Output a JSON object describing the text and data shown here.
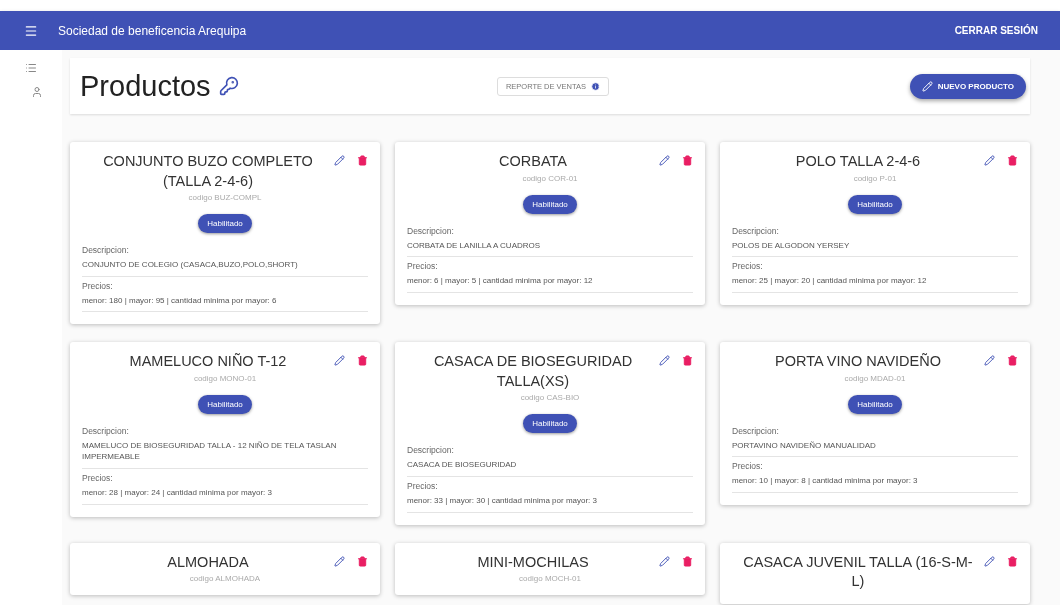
{
  "app_bar": {
    "title": "Sociedad de beneficencia Arequipa",
    "logout": "CERRAR SESIÓN"
  },
  "header": {
    "title": "Productos",
    "report_button": "REPORTE DE VENTAS",
    "new_button": "NUEVO PRODUCTO"
  },
  "products": [
    {
      "name": "CONJUNTO BUZO COMPLETO (TALLA 2-4-6)",
      "code": "codigo BUZ-COMPL",
      "status": "Habilitado",
      "description_label": "Descripcion:",
      "description": "CONJUNTO DE COLEGIO (CASACA,BUZO,POLO,SHORT)",
      "prices_label": "Precios:",
      "prices": "menor: 180 | mayor: 95 | cantidad minima por mayor: 6"
    },
    {
      "name": "CORBATA",
      "code": "codigo COR-01",
      "status": "Habilitado",
      "description_label": "Descripcion:",
      "description": "CORBATA DE LANILLA A CUADROS",
      "prices_label": "Precios:",
      "prices": "menor: 6 | mayor: 5 | cantidad minima por mayor: 12"
    },
    {
      "name": "POLO TALLA 2-4-6",
      "code": "codigo P-01",
      "status": "Habilitado",
      "description_label": "Descripcion:",
      "description": "POLOS DE ALGODON YERSEY",
      "prices_label": "Precios:",
      "prices": "menor: 25 | mayor: 20 | cantidad minima por mayor: 12"
    },
    {
      "name": "MAMELUCO NIÑO T-12",
      "code": "codigo MONO-01",
      "status": "Habilitado",
      "description_label": "Descripcion:",
      "description": "MAMELUCO DE BIOSEGURIDAD TALLA - 12 NIÑO DE TELA TASLAN IMPERMEABLE",
      "prices_label": "Precios:",
      "prices": "menor: 28 | mayor: 24 | cantidad minima por mayor: 3"
    },
    {
      "name": "CASACA DE BIOSEGURIDAD TALLA(XS)",
      "code": "codigo CAS-BIO",
      "status": "Habilitado",
      "description_label": "Descripcion:",
      "description": "CASACA DE BIOSEGURIDAD",
      "prices_label": "Precios:",
      "prices": "menor: 33 | mayor: 30 | cantidad minima por mayor: 3"
    },
    {
      "name": "PORTA VINO NAVIDEÑO",
      "code": "codigo MDAD-01",
      "status": "Habilitado",
      "description_label": "Descripcion:",
      "description": "PORTAVINO NAVIDEÑO  MANUALIDAD",
      "prices_label": "Precios:",
      "prices": "menor: 10 | mayor: 8 | cantidad minima por mayor: 3"
    },
    {
      "name": "ALMOHADA",
      "code": "codigo ALMOHADA"
    },
    {
      "name": "MINI-MOCHILAS",
      "code": "codigo MOCH-01"
    },
    {
      "name": "CASACA JUVENIL TALLA (16-S-M-L)"
    }
  ]
}
